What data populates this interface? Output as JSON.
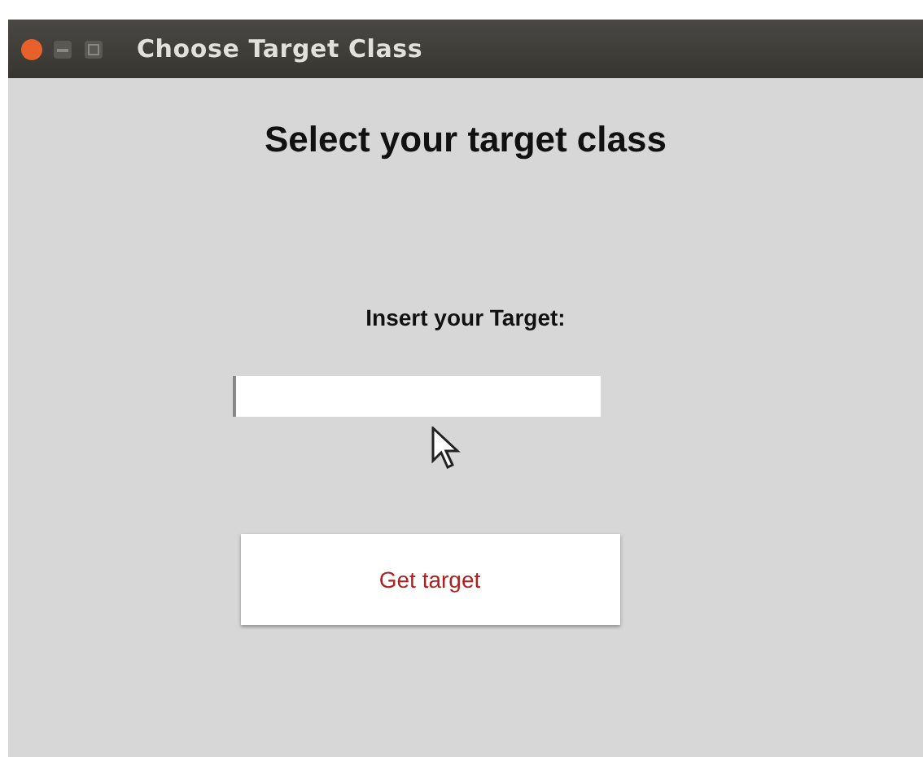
{
  "window": {
    "title": "Choose Target Class"
  },
  "heading": "Select your target class",
  "target_field": {
    "label": "Insert your Target:"
  },
  "buttons": [
    {
      "label": "Get target"
    }
  ]
}
